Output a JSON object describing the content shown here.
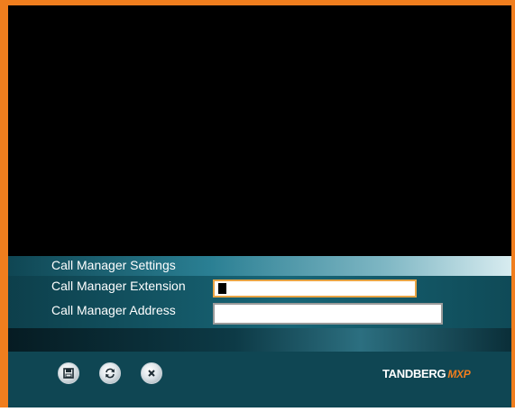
{
  "window": {
    "accent_color": "#f07e1e",
    "panel_color": "#0f4653"
  },
  "settings": {
    "title": "Call Manager Settings",
    "fields": [
      {
        "label": "Call Manager Extension",
        "value": "",
        "focused": true
      },
      {
        "label": "Call Manager Address",
        "value": "",
        "focused": false
      }
    ]
  },
  "footer": {
    "buttons": [
      {
        "icon": "save-icon"
      },
      {
        "icon": "refresh-icon"
      },
      {
        "icon": "cancel-icon"
      }
    ],
    "brand": {
      "name": "TANDBERG",
      "model": "MXP"
    }
  }
}
